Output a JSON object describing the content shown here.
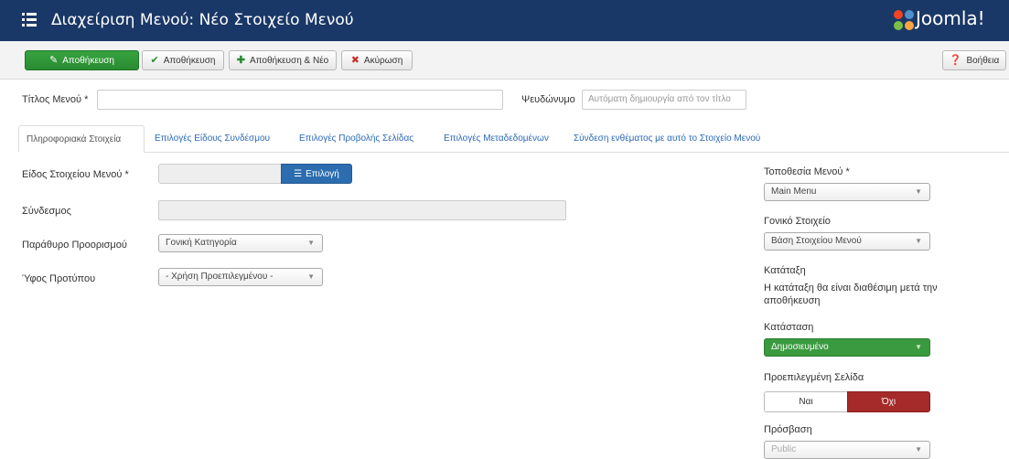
{
  "header": {
    "title": "Διαχείριση Μενού: Νέο Στοιχείο Μενού",
    "logo_text": "Joomla!"
  },
  "toolbar": {
    "save_label": "Αποθήκευση",
    "save_close_label": "Αποθήκευση",
    "save_new_label": "Αποθήκευση & Νέο",
    "cancel_label": "Ακύρωση",
    "help_label": "Βοήθεια"
  },
  "form": {
    "title_label": "Τίτλος Μενού *",
    "title_value": "",
    "alias_label": "Ψευδώνυμο",
    "alias_placeholder": "Αυτόματη δημιουργία από τον τίτλο"
  },
  "tabs": [
    {
      "label": "Πληροφοριακά Στοιχεία"
    },
    {
      "label": "Επιλογές Είδους Συνδέσμου"
    },
    {
      "label": "Επιλογές Προβολής Σελίδας"
    },
    {
      "label": "Επιλογές Μεταδεδομένων"
    },
    {
      "label": "Σύνδεση ενθέματος με αυτό το Στοιχείο Μενού"
    }
  ],
  "details": {
    "type_label": "Είδος Στοιχείου Μενού *",
    "choose_label": "Επιλογή",
    "link_label": "Σύνδεσμος",
    "target_label": "Παράθυρο Προορισμού",
    "target_value": "Γονική Κατηγορία",
    "style_label": "Ύφος Προτύπου",
    "style_value": "- Χρήση Προεπιλεγμένου -"
  },
  "sidebar": {
    "menu_label": "Τοποθεσία Μενού *",
    "menu_value": "Main Menu",
    "parent_label": "Γονικό Στοιχείο",
    "parent_value": "Βάση Στοιχείου Μενού",
    "ordering_label": "Κατάταξη",
    "ordering_note": "Η κατάταξη θα είναι διαθέσιμη μετά την αποθήκευση",
    "status_label": "Κατάσταση",
    "status_value": "Δημοσιευμένο",
    "home_label": "Προεπιλεγμένη Σελίδα",
    "home_yes": "Ναι",
    "home_no": "Όχι",
    "access_label": "Πρόσβαση",
    "access_value": "Public"
  },
  "colors": {
    "header_bg": "#1a3867",
    "save_green": "#2a8b32",
    "status_green": "#3a9a3f",
    "no_red": "#a52a2a",
    "choose_blue": "#2c6db0"
  }
}
